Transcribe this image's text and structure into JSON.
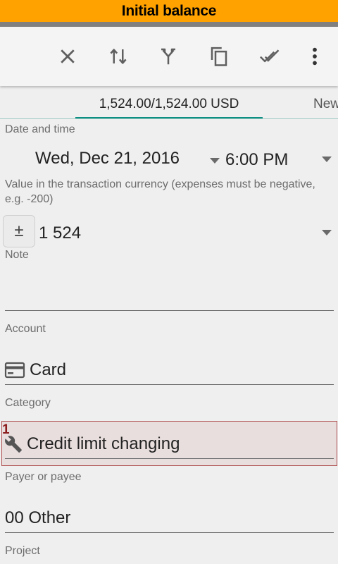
{
  "title_bar": {
    "text": "Initial balance"
  },
  "toolbar": {
    "icons": [
      "close-icon",
      "swap-vertical-icon",
      "split-icon",
      "copy-icon",
      "done-all-icon",
      "more-vert-icon"
    ]
  },
  "tabs": {
    "active": "1,524.00/1,524.00 USD",
    "next": "New"
  },
  "form": {
    "date_label": "Date and time",
    "date_value": "Wed, Dec 21, 2016",
    "time_value": "6:00 PM",
    "value_label": "Value in the transaction currency (expenses must be negative, e.g. -200)",
    "plus_minus": "±",
    "amount": "1 524",
    "note_label": "Note",
    "note_value": "",
    "account_label": "Account",
    "account_value": "Card",
    "category_label": "Category",
    "category_value": "Credit limit changing",
    "category_badge": "1",
    "payee_label": "Payer or payee",
    "payee_value": "00 Other",
    "project_label": "Project"
  },
  "colors": {
    "title_bar": "#ffa200",
    "tab_accent": "#0d8f84",
    "highlight_border": "#b05050",
    "highlight_fill": "#e9dede"
  }
}
